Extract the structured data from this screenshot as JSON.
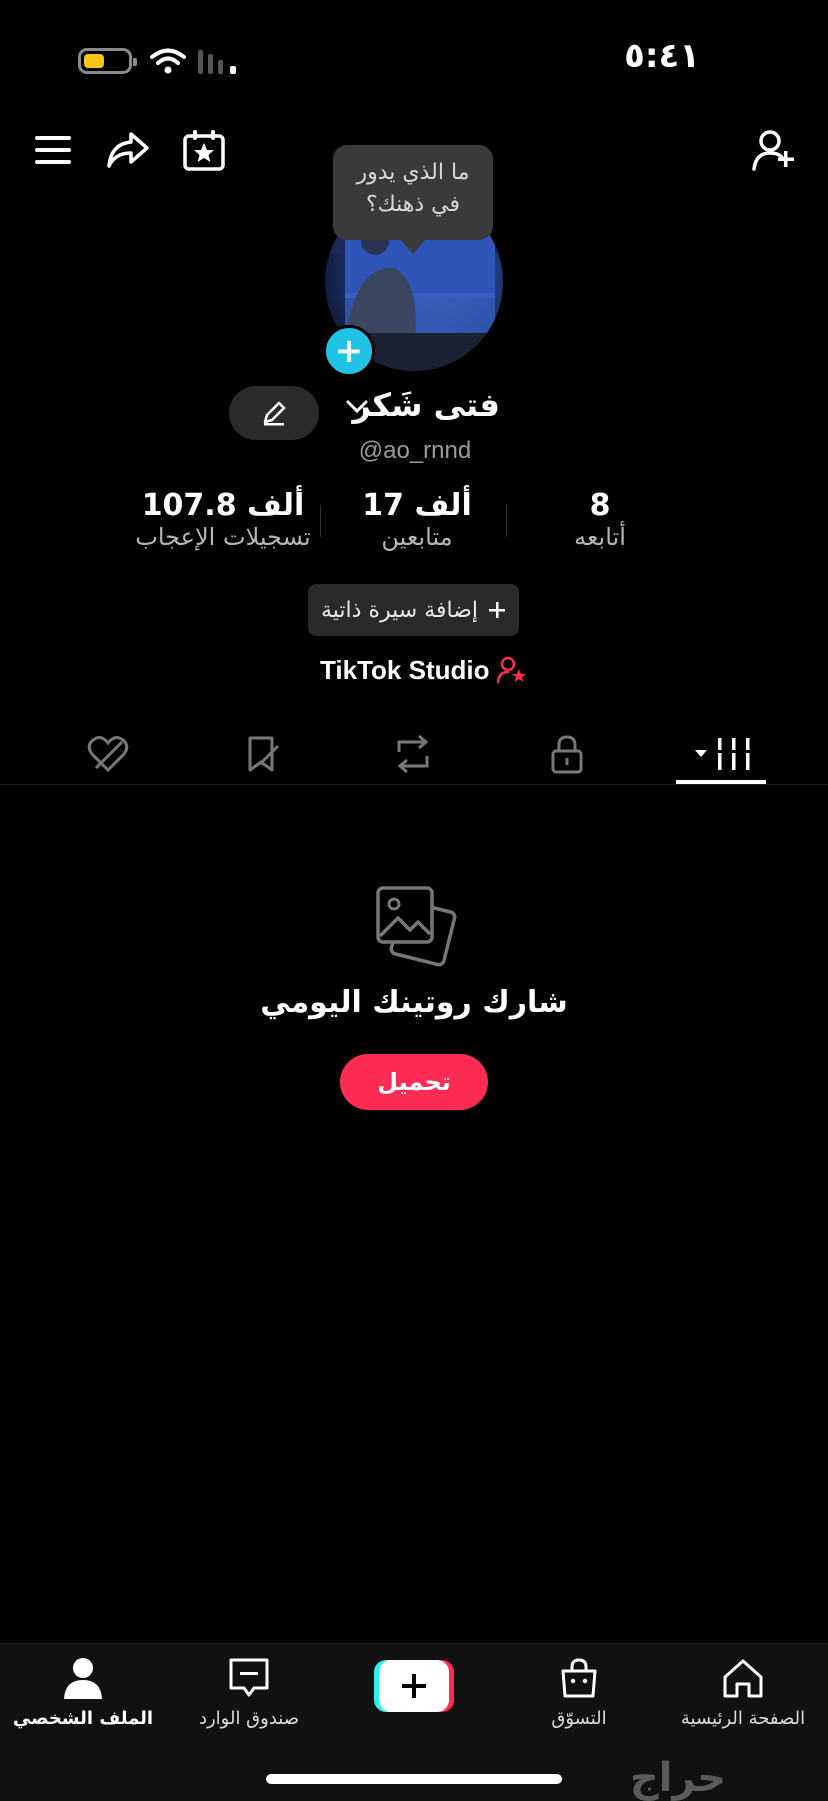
{
  "status_bar": {
    "time": "٥:٤١",
    "battery_color": "#f5c518"
  },
  "header": {
    "icons": [
      "menu-icon",
      "share-icon",
      "calendar-star-icon",
      "add-friend-icon"
    ]
  },
  "tooltip": {
    "line1": "ما الذي يدور",
    "line2": "في ذهنك؟"
  },
  "profile": {
    "name": "فتى شَكر",
    "handle": "@ao_rnnd"
  },
  "stats": [
    {
      "value": "8",
      "label": "أتابعه"
    },
    {
      "value": "17 ألف",
      "label": "متابعين"
    },
    {
      "value": "107.8 ألف",
      "label": "تسجيلات الإعجاب"
    }
  ],
  "bio": {
    "add_label": "إضافة سيرة ذاتية"
  },
  "studio": {
    "label": "TikTok Studio",
    "accent": "#fe2c55"
  },
  "tabs": [
    "videos-grid-icon",
    "lock-icon",
    "repost-icon",
    "favorites-icon",
    "liked-icon"
  ],
  "empty_state": {
    "message": "شارك روتينك اليومي",
    "button": "تحميل",
    "button_color": "#fe2c55"
  },
  "nav": {
    "profile": "الملف الشخصي",
    "inbox": "صندوق الوارد",
    "shop": "التسوّق",
    "home": "الصفحة الرئيسية"
  },
  "watermark": "حراج"
}
